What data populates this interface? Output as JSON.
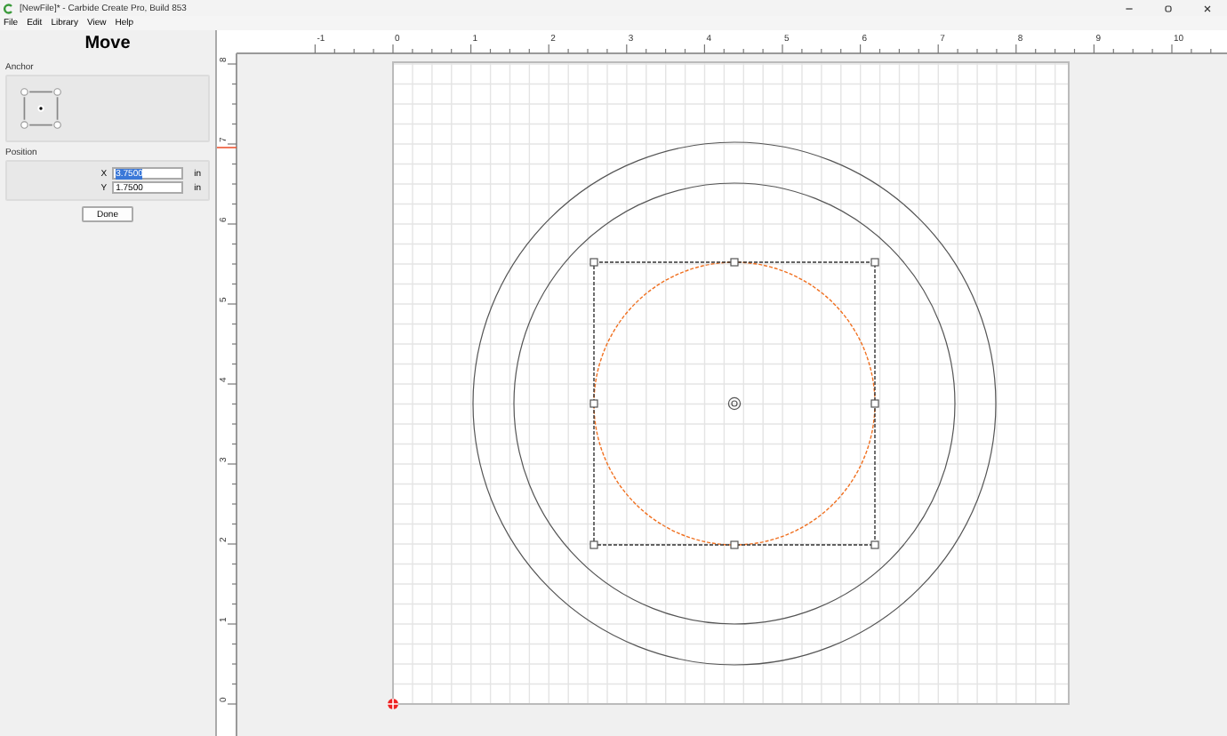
{
  "window": {
    "title": "[NewFile]* - Carbide Create Pro, Build 853"
  },
  "menu": [
    "File",
    "Edit",
    "Library",
    "View",
    "Help"
  ],
  "panel": {
    "title": "Move",
    "anchor": {
      "label": "Anchor",
      "points": [
        {
          "selected": false
        },
        {
          "selected": false
        },
        {
          "selected": false
        },
        {
          "selected": false
        },
        {
          "selected": true
        }
      ]
    },
    "position": {
      "label": "Position",
      "fields": [
        {
          "label": "X",
          "value": "3.7500",
          "highlighted": true,
          "unit": "in"
        },
        {
          "label": "Y",
          "value": "1.7500",
          "highlighted": false,
          "unit": "in"
        }
      ]
    },
    "button": "Done"
  },
  "rulers": {
    "horizontal": [
      "-1",
      "0",
      "1",
      "2",
      "3",
      "4",
      "5",
      "6",
      "7",
      "8",
      "9",
      "10"
    ],
    "vertical": [
      "8",
      "7",
      "6",
      "5",
      "4",
      "3",
      "2",
      "1",
      "0"
    ]
  }
}
